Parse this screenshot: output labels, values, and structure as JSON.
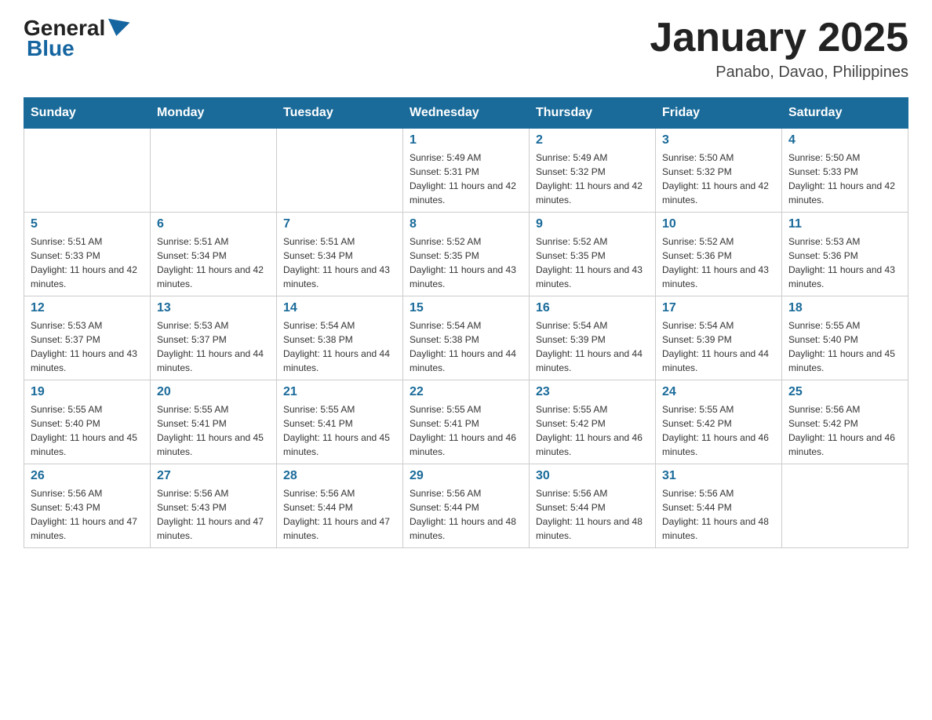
{
  "header": {
    "logo": {
      "general": "General",
      "blue": "Blue"
    },
    "title": "January 2025",
    "subtitle": "Panabo, Davao, Philippines"
  },
  "days_of_week": [
    "Sunday",
    "Monday",
    "Tuesday",
    "Wednesday",
    "Thursday",
    "Friday",
    "Saturday"
  ],
  "weeks": [
    [
      {
        "day": "",
        "info": ""
      },
      {
        "day": "",
        "info": ""
      },
      {
        "day": "",
        "info": ""
      },
      {
        "day": "1",
        "info": "Sunrise: 5:49 AM\nSunset: 5:31 PM\nDaylight: 11 hours and 42 minutes."
      },
      {
        "day": "2",
        "info": "Sunrise: 5:49 AM\nSunset: 5:32 PM\nDaylight: 11 hours and 42 minutes."
      },
      {
        "day": "3",
        "info": "Sunrise: 5:50 AM\nSunset: 5:32 PM\nDaylight: 11 hours and 42 minutes."
      },
      {
        "day": "4",
        "info": "Sunrise: 5:50 AM\nSunset: 5:33 PM\nDaylight: 11 hours and 42 minutes."
      }
    ],
    [
      {
        "day": "5",
        "info": "Sunrise: 5:51 AM\nSunset: 5:33 PM\nDaylight: 11 hours and 42 minutes."
      },
      {
        "day": "6",
        "info": "Sunrise: 5:51 AM\nSunset: 5:34 PM\nDaylight: 11 hours and 42 minutes."
      },
      {
        "day": "7",
        "info": "Sunrise: 5:51 AM\nSunset: 5:34 PM\nDaylight: 11 hours and 43 minutes."
      },
      {
        "day": "8",
        "info": "Sunrise: 5:52 AM\nSunset: 5:35 PM\nDaylight: 11 hours and 43 minutes."
      },
      {
        "day": "9",
        "info": "Sunrise: 5:52 AM\nSunset: 5:35 PM\nDaylight: 11 hours and 43 minutes."
      },
      {
        "day": "10",
        "info": "Sunrise: 5:52 AM\nSunset: 5:36 PM\nDaylight: 11 hours and 43 minutes."
      },
      {
        "day": "11",
        "info": "Sunrise: 5:53 AM\nSunset: 5:36 PM\nDaylight: 11 hours and 43 minutes."
      }
    ],
    [
      {
        "day": "12",
        "info": "Sunrise: 5:53 AM\nSunset: 5:37 PM\nDaylight: 11 hours and 43 minutes."
      },
      {
        "day": "13",
        "info": "Sunrise: 5:53 AM\nSunset: 5:37 PM\nDaylight: 11 hours and 44 minutes."
      },
      {
        "day": "14",
        "info": "Sunrise: 5:54 AM\nSunset: 5:38 PM\nDaylight: 11 hours and 44 minutes."
      },
      {
        "day": "15",
        "info": "Sunrise: 5:54 AM\nSunset: 5:38 PM\nDaylight: 11 hours and 44 minutes."
      },
      {
        "day": "16",
        "info": "Sunrise: 5:54 AM\nSunset: 5:39 PM\nDaylight: 11 hours and 44 minutes."
      },
      {
        "day": "17",
        "info": "Sunrise: 5:54 AM\nSunset: 5:39 PM\nDaylight: 11 hours and 44 minutes."
      },
      {
        "day": "18",
        "info": "Sunrise: 5:55 AM\nSunset: 5:40 PM\nDaylight: 11 hours and 45 minutes."
      }
    ],
    [
      {
        "day": "19",
        "info": "Sunrise: 5:55 AM\nSunset: 5:40 PM\nDaylight: 11 hours and 45 minutes."
      },
      {
        "day": "20",
        "info": "Sunrise: 5:55 AM\nSunset: 5:41 PM\nDaylight: 11 hours and 45 minutes."
      },
      {
        "day": "21",
        "info": "Sunrise: 5:55 AM\nSunset: 5:41 PM\nDaylight: 11 hours and 45 minutes."
      },
      {
        "day": "22",
        "info": "Sunrise: 5:55 AM\nSunset: 5:41 PM\nDaylight: 11 hours and 46 minutes."
      },
      {
        "day": "23",
        "info": "Sunrise: 5:55 AM\nSunset: 5:42 PM\nDaylight: 11 hours and 46 minutes."
      },
      {
        "day": "24",
        "info": "Sunrise: 5:55 AM\nSunset: 5:42 PM\nDaylight: 11 hours and 46 minutes."
      },
      {
        "day": "25",
        "info": "Sunrise: 5:56 AM\nSunset: 5:42 PM\nDaylight: 11 hours and 46 minutes."
      }
    ],
    [
      {
        "day": "26",
        "info": "Sunrise: 5:56 AM\nSunset: 5:43 PM\nDaylight: 11 hours and 47 minutes."
      },
      {
        "day": "27",
        "info": "Sunrise: 5:56 AM\nSunset: 5:43 PM\nDaylight: 11 hours and 47 minutes."
      },
      {
        "day": "28",
        "info": "Sunrise: 5:56 AM\nSunset: 5:44 PM\nDaylight: 11 hours and 47 minutes."
      },
      {
        "day": "29",
        "info": "Sunrise: 5:56 AM\nSunset: 5:44 PM\nDaylight: 11 hours and 48 minutes."
      },
      {
        "day": "30",
        "info": "Sunrise: 5:56 AM\nSunset: 5:44 PM\nDaylight: 11 hours and 48 minutes."
      },
      {
        "day": "31",
        "info": "Sunrise: 5:56 AM\nSunset: 5:44 PM\nDaylight: 11 hours and 48 minutes."
      },
      {
        "day": "",
        "info": ""
      }
    ]
  ]
}
